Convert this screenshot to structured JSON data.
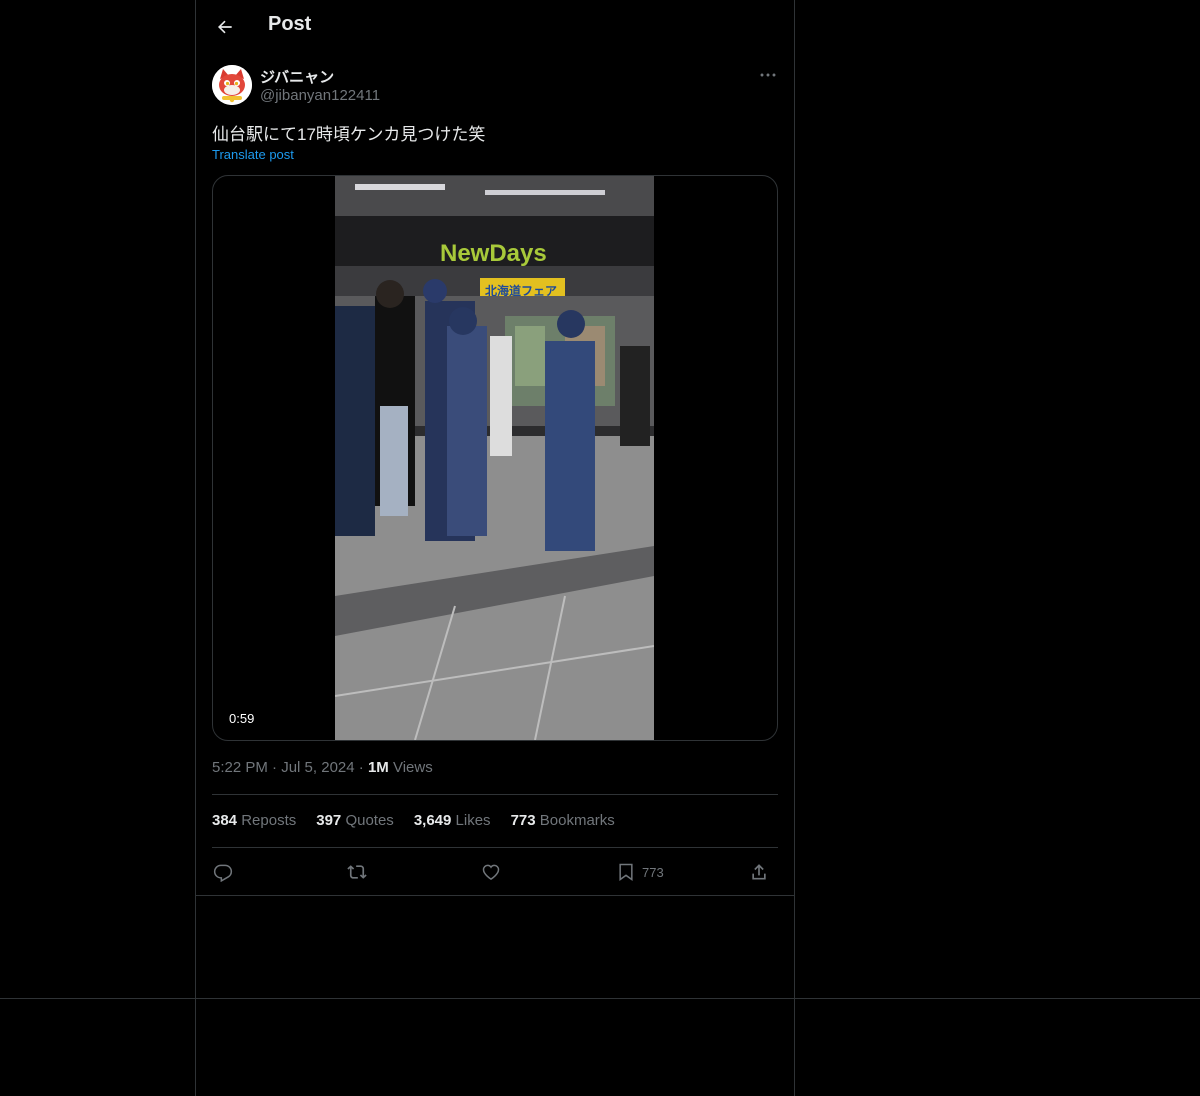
{
  "header": {
    "title": "Post"
  },
  "author": {
    "display_name": "ジバニャン",
    "handle": "@jibanyan122411"
  },
  "post": {
    "text": "仙台駅にて17時頃ケンカ見つけた笑",
    "translate_label": "Translate post",
    "video_duration": "0:59",
    "video_sign_text": "NewDays",
    "video_banner_text": "北海道フェア",
    "time": "5:22 PM",
    "date": "Jul 5, 2024",
    "views_count": "1M",
    "views_label": "Views"
  },
  "stats": [
    {
      "count": "384",
      "label": "Reposts"
    },
    {
      "count": "397",
      "label": "Quotes"
    },
    {
      "count": "3,649",
      "label": "Likes"
    },
    {
      "count": "773",
      "label": "Bookmarks"
    }
  ],
  "actions": {
    "bookmark_count": "773"
  },
  "colors": {
    "background": "#000000",
    "text": "#e7e9ea",
    "muted": "#71767b",
    "link": "#1d9bf0",
    "border": "#2f3336"
  }
}
